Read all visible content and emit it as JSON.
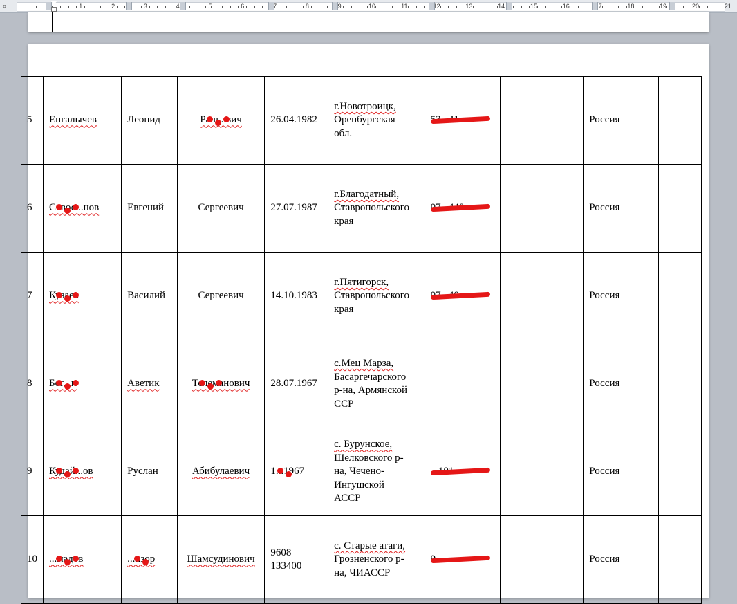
{
  "ruler": {
    "numbers": [
      "1",
      "2",
      "3",
      "4",
      "5",
      "6",
      "7",
      "8",
      "9",
      "10",
      "11",
      "12",
      "13",
      "14",
      "15",
      "16",
      "17",
      "18",
      "19",
      "20",
      "21"
    ]
  },
  "table": {
    "rows": [
      {
        "num": "5",
        "surname": "Енгалычев",
        "name": "Леонид",
        "patronymic": "Раш...вич",
        "dob": "26.04.1982",
        "place": [
          "г.Новотроицк,",
          "Оренбургская",
          "обл."
        ],
        "passport": "53...41",
        "country": "Россия",
        "passport_redacted": true,
        "patronymic_redacted": true
      },
      {
        "num": "6",
        "surname": "Севос...нов",
        "name": "Евгений",
        "patronymic": "Сергеевич",
        "dob": "27.07.1987",
        "place": [
          "г.Благодатный,",
          "Ставропольского",
          "края"
        ],
        "passport": "07...440",
        "country": "Россия",
        "passport_redacted": true,
        "surname_redacted": true
      },
      {
        "num": "7",
        "surname": "Кузаев",
        "name": "Василий",
        "patronymic": "Сергеевич",
        "dob": "14.10.1983",
        "place": [
          "г.Пятигорск,",
          "Ставропольского",
          "края"
        ],
        "passport": "07...40",
        "country": "Россия",
        "passport_redacted": true,
        "surname_redacted": true
      },
      {
        "num": "8",
        "surname": "Бог...н",
        "name": "Аветик",
        "patronymic": "Телеманович",
        "dob": "28.07.1967",
        "place": [
          "с.Мец Марза,",
          "Басаргечарского",
          "р-на, Армянской",
          "ССР"
        ],
        "passport": "",
        "country": "Россия",
        "surname_redacted": true,
        "patronymic_redacted": true
      },
      {
        "num": "9",
        "surname": "Кудай...ов",
        "name": "Руслан",
        "patronymic": "Абибулаевич",
        "dob": "1...1967",
        "place": [
          "с. Бурунское,",
          "Шелковского р-",
          "на, Чечено-",
          "Ингушской",
          "АССР"
        ],
        "passport": "...101",
        "country": "Россия",
        "passport_redacted": true,
        "surname_redacted": true,
        "dob_redacted": true
      },
      {
        "num": "10",
        "surname": "...мадов",
        "name": "...изор",
        "patronymic": "Шамсудинович",
        "dob": "9608 133400",
        "place": [
          "с. Старые атаги,",
          "Грозненского р-",
          "на, ЧИАССР"
        ],
        "passport": "9...",
        "country": "Россия",
        "passport_redacted": true,
        "surname_redacted": true,
        "name_redacted": true
      }
    ]
  },
  "colors": {
    "redaction": "#e51717",
    "workspace": "#b9bec6"
  }
}
